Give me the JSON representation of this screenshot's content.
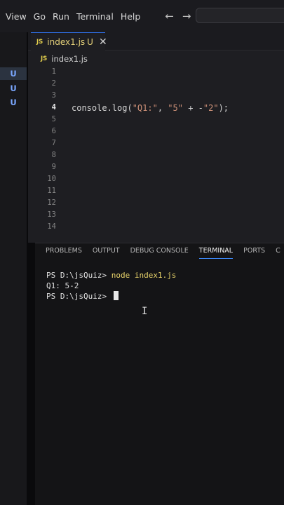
{
  "menubar": {
    "items": [
      "View",
      "Go",
      "Run",
      "Terminal",
      "Help"
    ],
    "back_icon": "arrow-left-icon",
    "forward_icon": "arrow-right-icon"
  },
  "activity": {
    "more": "···",
    "badges": [
      "U",
      "U",
      "U"
    ]
  },
  "editor": {
    "tab": {
      "badge": "JS",
      "name": "index1.js",
      "status": "U",
      "close": "✕"
    },
    "breadcrumb": {
      "badge": "JS",
      "file": "index1.js"
    },
    "line_numbers": [
      "1",
      "2",
      "3",
      "4",
      "5",
      "6",
      "7",
      "8",
      "9",
      "10",
      "11",
      "12",
      "13",
      "14"
    ],
    "current_line": "4",
    "code": {
      "line4": {
        "p1": "console.log(",
        "s1": "\"Q1:\"",
        "p2": ", ",
        "s2": "\"5\"",
        "p3": " + -",
        "s3": "\"2\"",
        "p4": ");"
      }
    }
  },
  "panel": {
    "tabs": [
      "PROBLEMS",
      "OUTPUT",
      "DEBUG CONSOLE",
      "TERMINAL",
      "PORTS",
      "C"
    ],
    "active_tab": "TERMINAL",
    "terminal": {
      "prompt1": "PS D:\\jsQuiz> ",
      "command1": "node index1.js",
      "output1": "Q1: 5-2",
      "prompt2": "PS D:\\jsQuiz> "
    }
  },
  "colors": {
    "accent": "#3d8bff",
    "string": "#ce9178",
    "modified": "#e6d27a",
    "js_badge": "#e3cf4d"
  }
}
